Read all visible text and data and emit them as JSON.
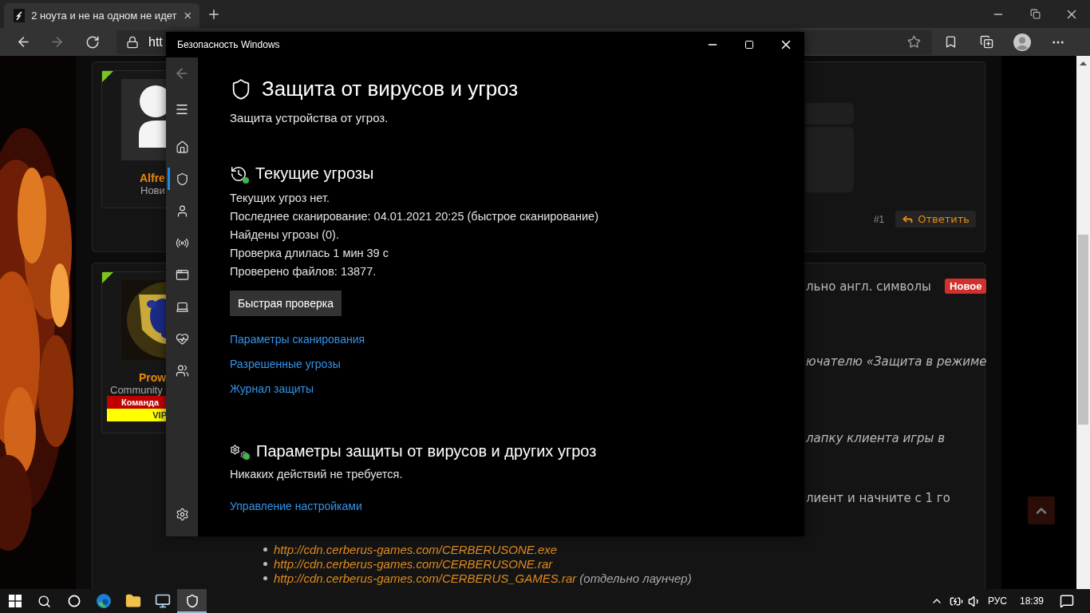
{
  "browser": {
    "tab": {
      "title": "2 ноута и не на одном не идет"
    },
    "address": "htt"
  },
  "forum": {
    "posts": [
      {
        "user": {
          "name": "Alfre",
          "title": "Нови",
          "kind": "silhouette"
        },
        "number": "#1",
        "reply": "Ответить"
      },
      {
        "user": {
          "name": "Prow",
          "title": "Community",
          "kind": "picture",
          "banners": [
            {
              "text": "Команда",
              "color": "#c00000"
            },
            {
              "text": "VIP",
              "color": "#ffff00"
            }
          ]
        },
        "badge": "Новое",
        "lines": [
          {
            "text": "льно англ. символы",
            "kind": "plain"
          },
          {
            "text": "ючателю «Защита в режиме",
            "kind": "italic"
          },
          {
            "text": "лапку клиента игры в",
            "kind": "italic"
          },
          {
            "text": "лиент и начните с 1 го",
            "kind": "plain"
          }
        ],
        "links": [
          {
            "url": "http://cdn.cerberus-games.com/CERBERUSONE.exe"
          },
          {
            "url": "http://cdn.cerberus-games.com/CERBERUSONE.rar"
          },
          {
            "url": "http://cdn.cerberus-games.com/CERBERUS_GAMES.rar",
            "note": "(отдельно лаунчер)"
          }
        ]
      }
    ]
  },
  "security_window": {
    "title": "Безопасность Windows",
    "nav": [
      {
        "kind": "home",
        "selected": false
      },
      {
        "kind": "shield",
        "selected": true
      },
      {
        "kind": "account",
        "selected": false
      },
      {
        "kind": "network",
        "selected": false
      },
      {
        "kind": "app",
        "selected": false
      },
      {
        "kind": "device",
        "selected": false
      },
      {
        "kind": "health",
        "selected": false
      },
      {
        "kind": "family",
        "selected": false
      }
    ],
    "heading": "Защита от вирусов и угроз",
    "subtitle": "Защита устройства от угроз.",
    "threats": {
      "heading": "Текущие угрозы",
      "lines": [
        "Текущих угроз нет.",
        "Последнее сканирование: 04.01.2021 20:25 (быстрое сканирование)",
        "Найдены угрозы (0).",
        "Проверка длилась 1 мин 39 с",
        "Проверено файлов: 13877."
      ],
      "button": "Быстрая проверка",
      "links": [
        "Параметры сканирования",
        "Разрешенные угрозы",
        "Журнал защиты"
      ]
    },
    "settings": {
      "heading": "Параметры защиты от вирусов и других угроз",
      "status": "Никаких действий не требуется.",
      "link": "Управление настройками"
    }
  },
  "taskbar": {
    "apps": [
      {
        "kind": "edge",
        "selected": false
      },
      {
        "kind": "explorer",
        "selected": false
      },
      {
        "kind": "monitor",
        "selected": false
      },
      {
        "kind": "security",
        "selected": true
      }
    ],
    "language": "РУС",
    "time": "18:39"
  }
}
